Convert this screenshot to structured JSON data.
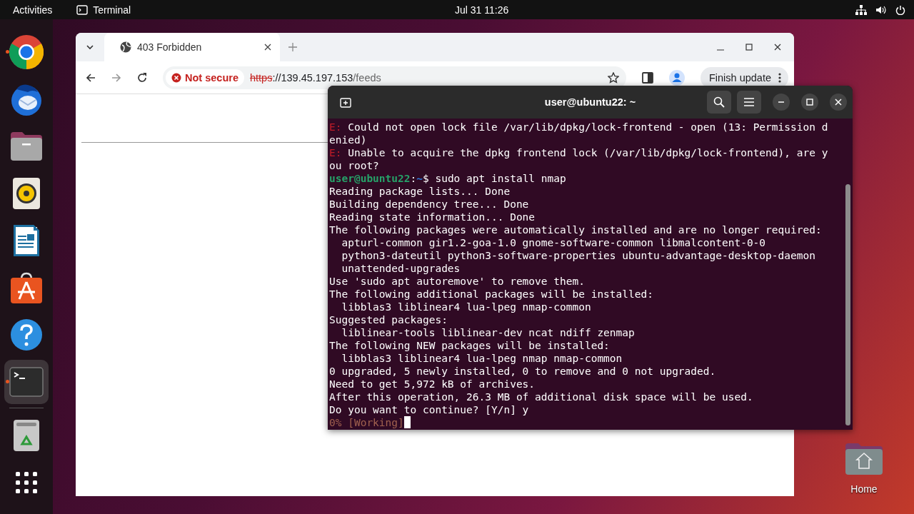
{
  "top_bar": {
    "activities": "Activities",
    "app": "Terminal",
    "clock": "Jul 31  11:26"
  },
  "dock": {
    "items": [
      {
        "kind": "browser",
        "running": true,
        "selected": false
      },
      {
        "kind": "mail",
        "running": false,
        "selected": false
      },
      {
        "kind": "files",
        "running": false,
        "selected": false
      },
      {
        "kind": "music",
        "running": false,
        "selected": false
      },
      {
        "kind": "writer",
        "running": false,
        "selected": false
      },
      {
        "kind": "store",
        "running": false,
        "selected": false
      },
      {
        "kind": "help",
        "running": false,
        "selected": false
      },
      {
        "kind": "terminal",
        "running": true,
        "selected": true
      },
      {
        "kind": "separator"
      },
      {
        "kind": "trash",
        "running": false,
        "selected": false
      },
      {
        "kind": "apps",
        "running": false,
        "selected": false
      }
    ]
  },
  "browser": {
    "tab_title": "403 Forbidden",
    "security": "Not secure",
    "url_scheme": "https",
    "url_host": "://139.45.197.153",
    "url_path": "/feeds",
    "update_button": "Finish update"
  },
  "terminal": {
    "title": "user@ubuntu22: ~",
    "lines": [
      {
        "kind": "error",
        "prefix": "E:",
        "text": " Could not open lock file /var/lib/dpkg/lock-frontend - open (13: Permission d"
      },
      {
        "kind": "plain",
        "text": "enied)"
      },
      {
        "kind": "error",
        "prefix": "E:",
        "text": " Unable to acquire the dpkg frontend lock (/var/lib/dpkg/lock-frontend), are y"
      },
      {
        "kind": "plain",
        "text": "ou root?"
      },
      {
        "kind": "prompt",
        "user_host": "user@ubuntu22",
        "separator": ":",
        "path": "~",
        "text": "$ sudo apt install nmap"
      },
      {
        "kind": "plain",
        "text": "Reading package lists... Done"
      },
      {
        "kind": "plain",
        "text": "Building dependency tree... Done"
      },
      {
        "kind": "plain",
        "text": "Reading state information... Done"
      },
      {
        "kind": "plain",
        "text": "The following packages were automatically installed and are no longer required:"
      },
      {
        "kind": "plain",
        "text": "  apturl-common gir1.2-goa-1.0 gnome-software-common libmalcontent-0-0"
      },
      {
        "kind": "plain",
        "text": "  python3-dateutil python3-software-properties ubuntu-advantage-desktop-daemon"
      },
      {
        "kind": "plain",
        "text": "  unattended-upgrades"
      },
      {
        "kind": "plain",
        "text": "Use 'sudo apt autoremove' to remove them."
      },
      {
        "kind": "plain",
        "text": "The following additional packages will be installed:"
      },
      {
        "kind": "plain",
        "text": "  libblas3 liblinear4 lua-lpeg nmap-common"
      },
      {
        "kind": "plain",
        "text": "Suggested packages:"
      },
      {
        "kind": "plain",
        "text": "  liblinear-tools liblinear-dev ncat ndiff zenmap"
      },
      {
        "kind": "plain",
        "text": "The following NEW packages will be installed:"
      },
      {
        "kind": "plain",
        "text": "  libblas3 liblinear4 lua-lpeg nmap nmap-common"
      },
      {
        "kind": "plain",
        "text": "0 upgraded, 5 newly installed, 0 to remove and 0 not upgraded."
      },
      {
        "kind": "plain",
        "text": "Need to get 5,972 kB of archives."
      },
      {
        "kind": "plain",
        "text": "After this operation, 26.3 MB of additional disk space will be used."
      },
      {
        "kind": "plain",
        "text": "Do you want to continue? [Y/n] y"
      },
      {
        "kind": "progress",
        "text": "0% [Working]"
      }
    ]
  },
  "desktop_icons": [
    {
      "label": "Home"
    }
  ]
}
